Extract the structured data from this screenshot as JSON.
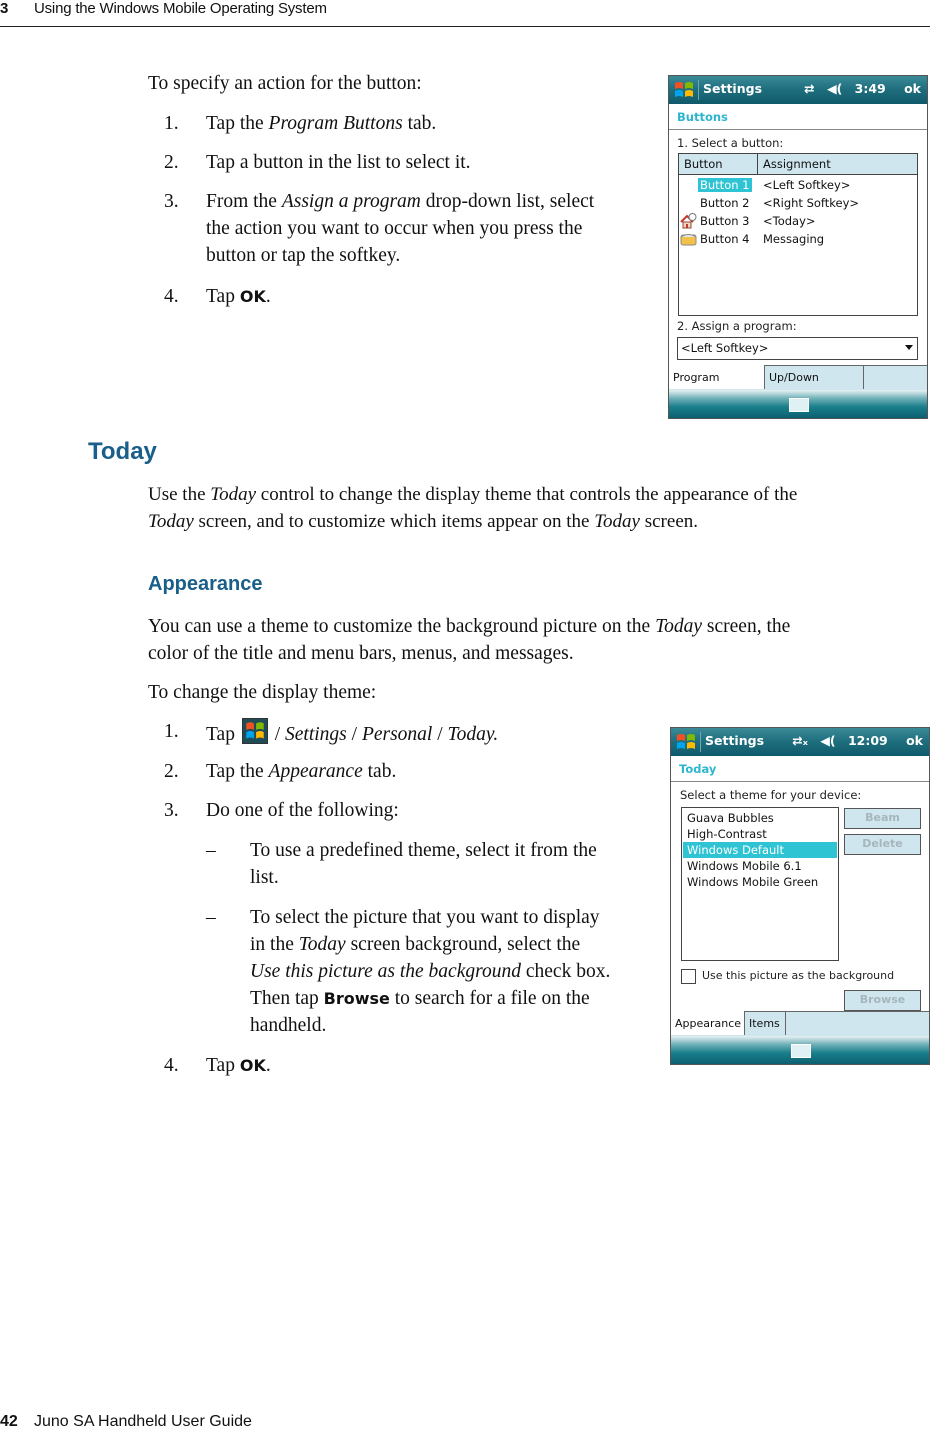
{
  "header": {
    "chapter_number": "3",
    "chapter_title": "Using the Windows Mobile Operating System"
  },
  "footer": {
    "page_number": "42",
    "book_title": "Juno SA Handheld User Guide"
  },
  "section_buttons": {
    "intro": "To specify an action for the button:",
    "steps": [
      {
        "n": "1.",
        "pre": "Tap the ",
        "em": "Program Buttons",
        "post": " tab."
      },
      {
        "n": "2.",
        "text": "Tap a button in the list to select it."
      },
      {
        "n": "3.",
        "pre": "From the ",
        "em": "Assign a program",
        "post_lines": [
          " drop-down list, select",
          "the action you want to occur when you press the",
          "button or tap the softkey."
        ]
      },
      {
        "n": "4.",
        "pre": "Tap ",
        "bold": "OK",
        "post": "."
      }
    ]
  },
  "screen_buttons": {
    "app_title": "Settings",
    "time": "3:49",
    "ok": "ok",
    "icons": [
      "windows-start-icon",
      "sync-connection-icon",
      "speaker-icon"
    ],
    "page_title": "Buttons",
    "select_label": "1. Select a button:",
    "columns": [
      "Button",
      "Assignment"
    ],
    "rows": [
      {
        "button": "Button 1",
        "assignment": "<Left Softkey>",
        "selected": true,
        "icon": ""
      },
      {
        "button": "Button 2",
        "assignment": "<Right Softkey>",
        "selected": false,
        "icon": ""
      },
      {
        "button": "Button 3",
        "assignment": "<Today>",
        "selected": false,
        "icon": "home-clock-icon"
      },
      {
        "button": "Button 4",
        "assignment": "Messaging",
        "selected": false,
        "icon": "envelope-icon"
      }
    ],
    "assign_label": "2. Assign a program:",
    "assign_value": "<Left Softkey>",
    "tabs": [
      {
        "label": "Program Buttons",
        "active": true
      },
      {
        "label": "Up/Down Control",
        "active": false
      }
    ]
  },
  "section_today": {
    "heading": "Today",
    "para_line1_pre": "Use the ",
    "para_line1_em": "Today",
    "para_line1_post": " control to change the display theme that controls the appearance of the",
    "para_line2_em1": "Today",
    "para_line2_mid": " screen, and to customize which items appear on the ",
    "para_line2_em2": "Today",
    "para_line2_post": " screen."
  },
  "section_appearance": {
    "heading": "Appearance",
    "para_line1_pre": "You can use a theme to customize the background picture on the ",
    "para_line1_em": "Today",
    "para_line1_post": " screen, the",
    "para_line2": "color of the title and menu bars, menus, and messages.",
    "intro": "To change the display theme:",
    "step1": {
      "n": "1.",
      "pre": "Tap",
      "path": [
        "Settings",
        "Personal",
        "Today."
      ]
    },
    "step2": {
      "n": "2.",
      "pre": "Tap the ",
      "em": "Appearance",
      "post": " tab."
    },
    "step3": {
      "n": "3.",
      "text": "Do one of the following:"
    },
    "bullets": [
      {
        "dash": "–",
        "lines": [
          "To use a predefined theme, select it from the",
          "list."
        ]
      },
      {
        "dash": "–",
        "l1": "To select the picture that you want to display",
        "l2_pre": "in the ",
        "l2_em": "Today",
        "l2_post": " screen background, select the",
        "l3_em": "Use this picture as the background",
        "l3_post": " check box.",
        "l4_pre": "Then tap ",
        "l4_bold": "Browse",
        "l4_post": " to search for a file on the",
        "l5": "handheld."
      }
    ],
    "step4": {
      "n": "4.",
      "pre": "Tap ",
      "bold": "OK",
      "post": "."
    }
  },
  "screen_today": {
    "app_title": "Settings",
    "time": "12:09",
    "ok": "ok",
    "page_title": "Today",
    "select_label": "Select a theme for your device:",
    "themes": [
      {
        "name": "Guava Bubbles",
        "selected": false
      },
      {
        "name": "High-Contrast",
        "selected": false
      },
      {
        "name": "Windows Default",
        "selected": true
      },
      {
        "name": "Windows Mobile 6.1",
        "selected": false
      },
      {
        "name": "Windows Mobile Green",
        "selected": false
      }
    ],
    "beam": "Beam",
    "delete": "Delete",
    "checkbox_label": "Use this picture as the background",
    "checkbox_checked": false,
    "browse": "Browse",
    "tabs": [
      {
        "label": "Appearance",
        "active": true
      },
      {
        "label": "Items",
        "active": false
      }
    ]
  }
}
